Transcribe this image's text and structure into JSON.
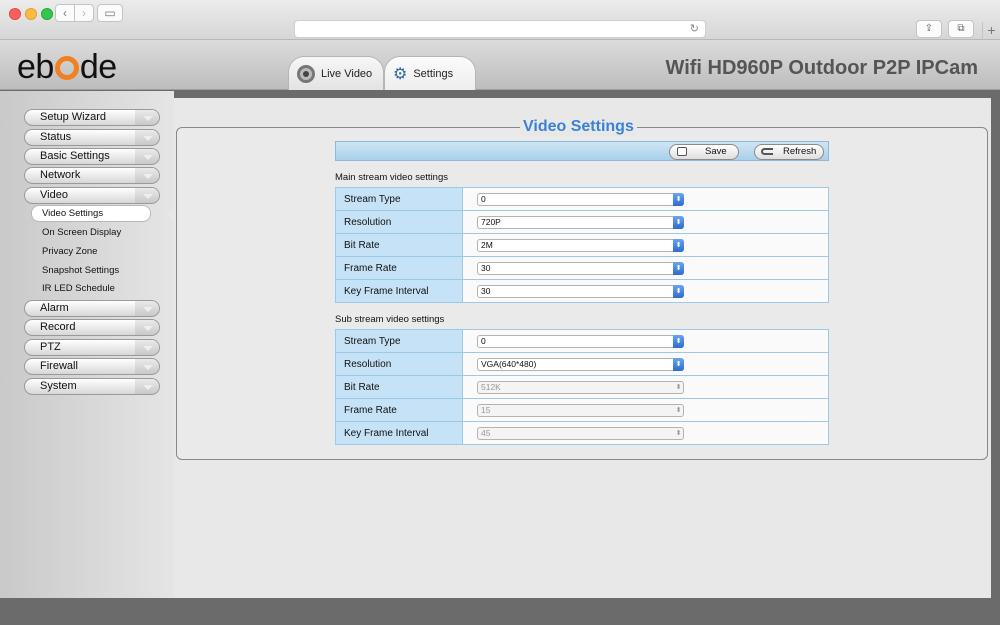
{
  "browser": {
    "back_glyph": "‹",
    "forward_glyph": "›",
    "sidebar_glyph": "▭",
    "reload_glyph": "↻",
    "share_glyph": "⇪",
    "tabs_glyph": "⧉",
    "newtab_glyph": "+"
  },
  "header": {
    "logo_prefix": "eb",
    "logo_suffix": "de",
    "product_title": "Wifi HD960P Outdoor P2P IPCam",
    "tabs": [
      {
        "label": "Live Video",
        "icon": "camera-icon"
      },
      {
        "label": "Settings",
        "icon": "gears-icon"
      }
    ],
    "gear_glyph": "⚙"
  },
  "sidebar": {
    "menu": [
      {
        "label": "Setup Wizard"
      },
      {
        "label": "Status"
      },
      {
        "label": "Basic Settings"
      },
      {
        "label": "Network"
      },
      {
        "label": "Video"
      },
      {
        "label": "Alarm"
      },
      {
        "label": "Record"
      },
      {
        "label": "PTZ"
      },
      {
        "label": "Firewall"
      },
      {
        "label": "System"
      }
    ],
    "video_submenu": [
      {
        "label": "Video Settings",
        "active": true
      },
      {
        "label": "On Screen Display"
      },
      {
        "label": "Privacy Zone"
      },
      {
        "label": "Snapshot Settings"
      },
      {
        "label": "IR LED Schedule"
      }
    ]
  },
  "content": {
    "title": "Video Settings",
    "toolbar": {
      "save_label": "Save",
      "refresh_label": "Refresh"
    },
    "main_stream": {
      "label": "Main stream video settings",
      "rows": [
        {
          "label": "Stream Type",
          "value": "0"
        },
        {
          "label": "Resolution",
          "value": "720P"
        },
        {
          "label": "Bit Rate",
          "value": "2M"
        },
        {
          "label": "Frame Rate",
          "value": "30"
        },
        {
          "label": "Key Frame Interval",
          "value": "30"
        }
      ]
    },
    "sub_stream": {
      "label": "Sub stream video settings",
      "rows": [
        {
          "label": "Stream Type",
          "value": "0"
        },
        {
          "label": "Resolution",
          "value": "VGA(640*480)"
        },
        {
          "label": "Bit Rate",
          "value": "512K",
          "disabled": true
        },
        {
          "label": "Frame Rate",
          "value": "15",
          "disabled": true
        },
        {
          "label": "Key Frame Interval",
          "value": "45",
          "disabled": true
        }
      ]
    },
    "select_arrow_glyph": "⬍"
  },
  "colors": {
    "title_blue": "#3a82d4",
    "logo_orange": "#f08020",
    "label_cell": "#c5e2f6"
  }
}
